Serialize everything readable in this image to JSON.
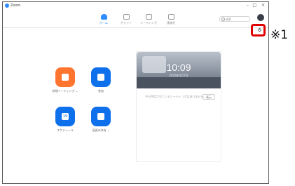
{
  "window": {
    "title": "Zoom",
    "minimize": "–",
    "maximize": "□",
    "close": "×"
  },
  "nav": {
    "tabs": [
      {
        "label": "ホーム",
        "icon": "home-icon",
        "active": true
      },
      {
        "label": "チャット",
        "icon": "chat-icon",
        "active": false
      },
      {
        "label": "ミーティング",
        "icon": "clock-icon",
        "active": false
      },
      {
        "label": "連絡先",
        "icon": "contacts-icon",
        "active": false
      }
    ],
    "search_placeholder": "検索"
  },
  "settings": {
    "icon": "gear-icon",
    "glyph": "⚙"
  },
  "annotation": "※1",
  "actions": [
    {
      "label": "新規ミーティング ⌄",
      "icon": "video-camera-icon",
      "color": "#FF742E"
    },
    {
      "label": "参加",
      "icon": "plus-icon",
      "color": "#0E71EB"
    },
    {
      "label": "スケジュール",
      "icon": "calendar-icon",
      "color": "#0E71EB",
      "badge": "19"
    },
    {
      "label": "画面の共有 ⌄",
      "icon": "share-screen-icon",
      "color": "#0E71EB"
    }
  ],
  "card": {
    "time": "10:09",
    "date": "2020年4月7日",
    "message": "今日予定されているミーティングはありません。",
    "button": "表示"
  },
  "colors": {
    "accent": "#2D8CFF",
    "orange": "#FF742E",
    "highlight": "#E00000"
  }
}
